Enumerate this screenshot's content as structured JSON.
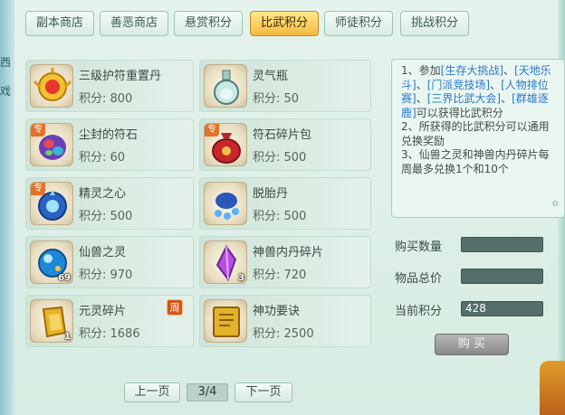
{
  "left_edge": [
    "西",
    "戏"
  ],
  "tabs": [
    {
      "label": "副本商店",
      "active": false
    },
    {
      "label": "善恶商店",
      "active": false
    },
    {
      "label": "悬赏积分",
      "active": false
    },
    {
      "label": "比武积分",
      "active": true
    },
    {
      "label": "师徒积分",
      "active": false
    },
    {
      "label": "挑战积分",
      "active": false
    }
  ],
  "items": [
    {
      "name": "三级护符重置丹",
      "points": "积分: 800",
      "icon": "golden-amulet-icon"
    },
    {
      "name": "灵气瓶",
      "points": "积分: 50",
      "icon": "spirit-vase-icon"
    },
    {
      "name": "尘封的符石",
      "points": "积分: 60",
      "icon": "rune-stone-icon",
      "tag": "专"
    },
    {
      "name": "符石碎片包",
      "points": "积分: 500",
      "icon": "fragment-bag-icon",
      "tag": "专"
    },
    {
      "name": "精灵之心",
      "points": "积分: 500",
      "icon": "spirit-heart-icon",
      "tag": "专"
    },
    {
      "name": "脱胎丹",
      "points": "积分: 500",
      "icon": "rebirth-pill-icon"
    },
    {
      "name": "仙兽之灵",
      "points": "积分: 970",
      "icon": "beast-orb-icon",
      "qty": "69"
    },
    {
      "name": "神兽内丹碎片",
      "points": "积分: 720",
      "icon": "crystal-shard-icon",
      "qty": "3"
    },
    {
      "name": "元灵碎片",
      "points": "积分: 1686",
      "icon": "yuanling-shard-icon",
      "qty": "1"
    },
    {
      "name": "神功要诀",
      "points": "积分: 2500",
      "icon": "skill-book-icon"
    }
  ],
  "week_badge": "周",
  "info": {
    "l1a": "1、参加",
    "l1b": "[生存大挑战]",
    "l1c": "、",
    "l1d": "[天地乐斗]",
    "l1e": "、",
    "l1f": "[门派竞技场]",
    "l1g": "、",
    "l1h": "[人物排位赛]",
    "l1i": "、",
    "l1j": "[三界比武大会]",
    "l1k": "、",
    "l1l": "[群雄逐鹿]",
    "l1m": "可以获得比武积分",
    "l2": "2、所获得的比武积分可以通用兑换奖励",
    "l3": "3、仙兽之灵和神兽内丹碎片每周最多兑换1个和10个"
  },
  "fields": {
    "buy_qty_label": "购买数量",
    "total_price_label": "物品总价",
    "current_points_label": "当前积分",
    "buy_qty_value": "",
    "total_price_value": "",
    "current_points_value": "428"
  },
  "buy_button": "购 买",
  "pagination": {
    "prev": "上一页",
    "page": "3/4",
    "next": "下一页"
  }
}
